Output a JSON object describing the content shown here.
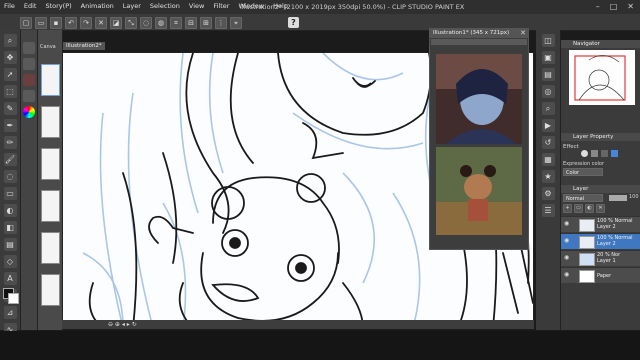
{
  "app": {
    "title": "Illustration2* (2100 x 2019px 350dpi 50.0%) - CLIP STUDIO PAINT EX",
    "menu": [
      "File",
      "Edit",
      "Story(P)",
      "Animation",
      "Layer",
      "Selection",
      "View",
      "Filter",
      "Window",
      "Help"
    ],
    "window_controls": [
      "–",
      "□",
      "✕"
    ]
  },
  "canvas": {
    "tab_label": "Illustration2*"
  },
  "reference_window": {
    "title": "Illustration1* (345 x 721px)"
  },
  "pages_panel": {
    "tab": "Canva"
  },
  "navigator": {
    "title": "Navigator"
  },
  "layer_property": {
    "title": "Layer Property",
    "effect_label": "Effect",
    "expression_color_label": "Expression color",
    "color_value": "Color"
  },
  "layer_panel": {
    "title": "Layer",
    "blend_mode": "Normal",
    "opacity": "100",
    "layers": [
      {
        "name": "100 % Normal\nLayer 2",
        "selected": false
      },
      {
        "name": "100 % Normal\nLayer 2",
        "selected": true
      },
      {
        "name": "20 % Nor\nLayer 1",
        "selected": false
      },
      {
        "name": "Paper",
        "selected": false
      }
    ]
  },
  "colors": {
    "accent": "#3f78c0",
    "panel_bg": "#3b3b3b",
    "canvas_line": "#1a1a1a",
    "sketch_blue": "#a9c6e8"
  }
}
